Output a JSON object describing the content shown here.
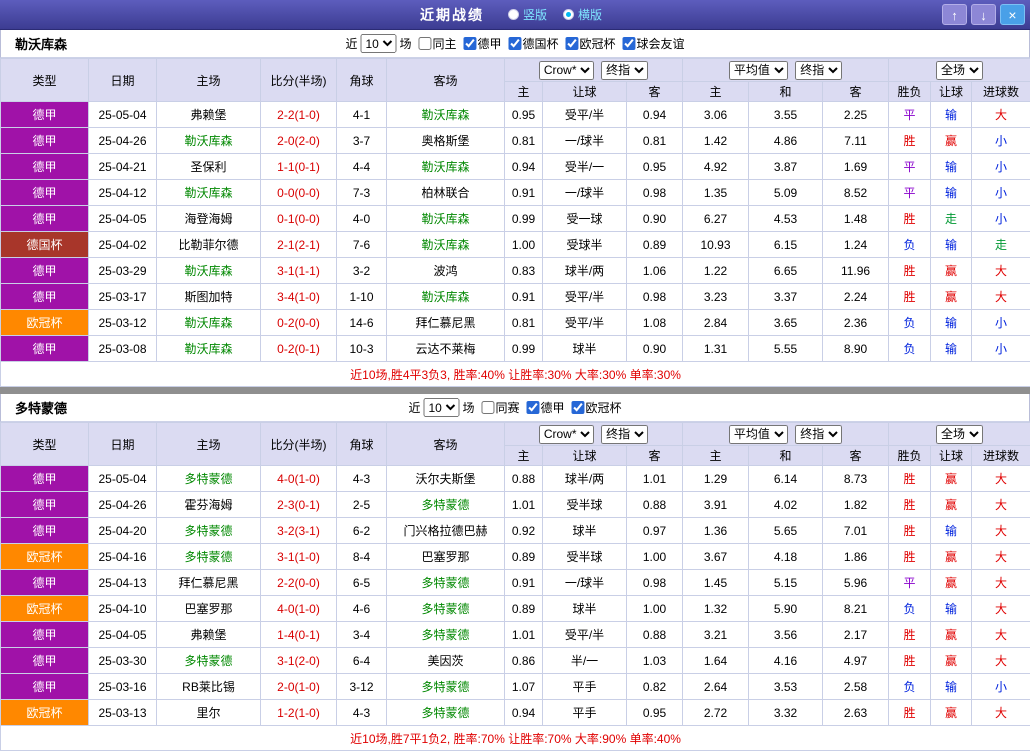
{
  "titlebar": {
    "title": "近期战绩",
    "radio_vertical": "竖版",
    "radio_horizontal": "横版",
    "up_button": "↑",
    "down_button": "↓",
    "close_button": "×"
  },
  "table_header": {
    "type": "类型",
    "date": "日期",
    "home": "主场",
    "score": "比分(半场)",
    "corner": "角球",
    "away": "客场",
    "odds_select1": "Crow*",
    "odds_select2": "终指",
    "avg_select1": "平均值",
    "avg_select2": "终指",
    "full_select": "全场",
    "odds_home": "主",
    "odds_handicap": "让球",
    "odds_away": "客",
    "avg_home": "主",
    "avg_draw": "和",
    "avg_away": "客",
    "result": "胜负",
    "handicap": "让球",
    "goals": "进球数"
  },
  "colors": {
    "badge_league": "#a012a8",
    "badge_cup": "#a8362a",
    "badge_ucl": "#ff8800",
    "win": "#e00000",
    "draw": "#8800cc",
    "loss": "#0022dd",
    "push": "#009933",
    "focus_team": "#008800",
    "score": "#d80000",
    "summary": "#e00000"
  },
  "sections": [
    {
      "team": "勒沃库森",
      "filter": {
        "near": "近",
        "count": "10",
        "games": "场",
        "options": [
          {
            "label": "同主",
            "checked": false
          },
          {
            "label": "德甲",
            "checked": true
          },
          {
            "label": "德国杯",
            "checked": true
          },
          {
            "label": "欧冠杯",
            "checked": true
          },
          {
            "label": "球会友谊",
            "checked": true
          }
        ]
      },
      "rows": [
        {
          "type": "德甲",
          "date": "25-05-04",
          "home": "弗赖堡",
          "home_focus": false,
          "score": "2-2(1-0)",
          "corner": "4-1",
          "away": "勒沃库森",
          "away_focus": true,
          "odds": [
            "0.95",
            "受平/半",
            "0.94"
          ],
          "avg": [
            "3.06",
            "3.55",
            "2.25"
          ],
          "result": "平",
          "handicap": "输",
          "goals": "大"
        },
        {
          "type": "德甲",
          "date": "25-04-26",
          "home": "勒沃库森",
          "home_focus": true,
          "score": "2-0(2-0)",
          "corner": "3-7",
          "away": "奥格斯堡",
          "away_focus": false,
          "odds": [
            "0.81",
            "一/球半",
            "0.81"
          ],
          "avg": [
            "1.42",
            "4.86",
            "7.11"
          ],
          "result": "胜",
          "handicap": "赢",
          "goals": "小"
        },
        {
          "type": "德甲",
          "date": "25-04-21",
          "home": "圣保利",
          "home_focus": false,
          "score": "1-1(0-1)",
          "corner": "4-4",
          "away": "勒沃库森",
          "away_focus": true,
          "odds": [
            "0.94",
            "受半/一",
            "0.95"
          ],
          "avg": [
            "4.92",
            "3.87",
            "1.69"
          ],
          "result": "平",
          "handicap": "输",
          "goals": "小"
        },
        {
          "type": "德甲",
          "date": "25-04-12",
          "home": "勒沃库森",
          "home_focus": true,
          "score": "0-0(0-0)",
          "corner": "7-3",
          "away": "柏林联合",
          "away_focus": false,
          "odds": [
            "0.91",
            "一/球半",
            "0.98"
          ],
          "avg": [
            "1.35",
            "5.09",
            "8.52"
          ],
          "result": "平",
          "handicap": "输",
          "goals": "小"
        },
        {
          "type": "德甲",
          "date": "25-04-05",
          "home": "海登海姆",
          "home_focus": false,
          "score": "0-1(0-0)",
          "corner": "4-0",
          "away": "勒沃库森",
          "away_focus": true,
          "odds": [
            "0.99",
            "受一球",
            "0.90"
          ],
          "avg": [
            "6.27",
            "4.53",
            "1.48"
          ],
          "result": "胜",
          "handicap": "走",
          "goals": "小"
        },
        {
          "type": "德国杯",
          "date": "25-04-02",
          "home": "比勒菲尔德",
          "home_focus": false,
          "score": "2-1(2-1)",
          "corner": "7-6",
          "away": "勒沃库森",
          "away_focus": true,
          "odds": [
            "1.00",
            "受球半",
            "0.89"
          ],
          "avg": [
            "10.93",
            "6.15",
            "1.24"
          ],
          "result": "负",
          "handicap": "输",
          "goals": "走"
        },
        {
          "type": "德甲",
          "date": "25-03-29",
          "home": "勒沃库森",
          "home_focus": true,
          "score": "3-1(1-1)",
          "corner": "3-2",
          "away": "波鸿",
          "away_focus": false,
          "odds": [
            "0.83",
            "球半/两",
            "1.06"
          ],
          "avg": [
            "1.22",
            "6.65",
            "11.96"
          ],
          "result": "胜",
          "handicap": "赢",
          "goals": "大"
        },
        {
          "type": "德甲",
          "date": "25-03-17",
          "home": "斯图加特",
          "home_focus": false,
          "score": "3-4(1-0)",
          "corner": "1-10",
          "away": "勒沃库森",
          "away_focus": true,
          "odds": [
            "0.91",
            "受平/半",
            "0.98"
          ],
          "avg": [
            "3.23",
            "3.37",
            "2.24"
          ],
          "result": "胜",
          "handicap": "赢",
          "goals": "大"
        },
        {
          "type": "欧冠杯",
          "date": "25-03-12",
          "home": "勒沃库森",
          "home_focus": true,
          "score": "0-2(0-0)",
          "corner": "14-6",
          "away": "拜仁慕尼黑",
          "away_focus": false,
          "odds": [
            "0.81",
            "受平/半",
            "1.08"
          ],
          "avg": [
            "2.84",
            "3.65",
            "2.36"
          ],
          "result": "负",
          "handicap": "输",
          "goals": "小"
        },
        {
          "type": "德甲",
          "date": "25-03-08",
          "home": "勒沃库森",
          "home_focus": true,
          "score": "0-2(0-1)",
          "corner": "10-3",
          "away": "云达不莱梅",
          "away_focus": false,
          "odds": [
            "0.99",
            "球半",
            "0.90"
          ],
          "avg": [
            "1.31",
            "5.55",
            "8.90"
          ],
          "result": "负",
          "handicap": "输",
          "goals": "小"
        }
      ],
      "summary": "近10场,胜4平3负3, 胜率:40% 让胜率:30% 大率:30% 单率:30%"
    },
    {
      "team": "多特蒙德",
      "filter": {
        "near": "近",
        "count": "10",
        "games": "场",
        "options": [
          {
            "label": "同赛",
            "checked": false
          },
          {
            "label": "德甲",
            "checked": true
          },
          {
            "label": "欧冠杯",
            "checked": true
          }
        ]
      },
      "rows": [
        {
          "type": "德甲",
          "date": "25-05-04",
          "home": "多特蒙德",
          "home_focus": true,
          "score": "4-0(1-0)",
          "corner": "4-3",
          "away": "沃尔夫斯堡",
          "away_focus": false,
          "odds": [
            "0.88",
            "球半/两",
            "1.01"
          ],
          "avg": [
            "1.29",
            "6.14",
            "8.73"
          ],
          "result": "胜",
          "handicap": "赢",
          "goals": "大"
        },
        {
          "type": "德甲",
          "date": "25-04-26",
          "home": "霍芬海姆",
          "home_focus": false,
          "score": "2-3(0-1)",
          "corner": "2-5",
          "away": "多特蒙德",
          "away_focus": true,
          "odds": [
            "1.01",
            "受半球",
            "0.88"
          ],
          "avg": [
            "3.91",
            "4.02",
            "1.82"
          ],
          "result": "胜",
          "handicap": "赢",
          "goals": "大"
        },
        {
          "type": "德甲",
          "date": "25-04-20",
          "home": "多特蒙德",
          "home_focus": true,
          "score": "3-2(3-1)",
          "corner": "6-2",
          "away": "门兴格拉德巴赫",
          "away_focus": false,
          "odds": [
            "0.92",
            "球半",
            "0.97"
          ],
          "avg": [
            "1.36",
            "5.65",
            "7.01"
          ],
          "result": "胜",
          "handicap": "输",
          "goals": "大"
        },
        {
          "type": "欧冠杯",
          "date": "25-04-16",
          "home": "多特蒙德",
          "home_focus": true,
          "score": "3-1(1-0)",
          "corner": "8-4",
          "away": "巴塞罗那",
          "away_focus": false,
          "odds": [
            "0.89",
            "受半球",
            "1.00"
          ],
          "avg": [
            "3.67",
            "4.18",
            "1.86"
          ],
          "result": "胜",
          "handicap": "赢",
          "goals": "大"
        },
        {
          "type": "德甲",
          "date": "25-04-13",
          "home": "拜仁慕尼黑",
          "home_focus": false,
          "score": "2-2(0-0)",
          "corner": "6-5",
          "away": "多特蒙德",
          "away_focus": true,
          "odds": [
            "0.91",
            "一/球半",
            "0.98"
          ],
          "avg": [
            "1.45",
            "5.15",
            "5.96"
          ],
          "result": "平",
          "handicap": "赢",
          "goals": "大"
        },
        {
          "type": "欧冠杯",
          "date": "25-04-10",
          "home": "巴塞罗那",
          "home_focus": false,
          "score": "4-0(1-0)",
          "corner": "4-6",
          "away": "多特蒙德",
          "away_focus": true,
          "odds": [
            "0.89",
            "球半",
            "1.00"
          ],
          "avg": [
            "1.32",
            "5.90",
            "8.21"
          ],
          "result": "负",
          "handicap": "输",
          "goals": "大"
        },
        {
          "type": "德甲",
          "date": "25-04-05",
          "home": "弗赖堡",
          "home_focus": false,
          "score": "1-4(0-1)",
          "corner": "3-4",
          "away": "多特蒙德",
          "away_focus": true,
          "odds": [
            "1.01",
            "受平/半",
            "0.88"
          ],
          "avg": [
            "3.21",
            "3.56",
            "2.17"
          ],
          "result": "胜",
          "handicap": "赢",
          "goals": "大"
        },
        {
          "type": "德甲",
          "date": "25-03-30",
          "home": "多特蒙德",
          "home_focus": true,
          "score": "3-1(2-0)",
          "corner": "6-4",
          "away": "美因茨",
          "away_focus": false,
          "odds": [
            "0.86",
            "半/一",
            "1.03"
          ],
          "avg": [
            "1.64",
            "4.16",
            "4.97"
          ],
          "result": "胜",
          "handicap": "赢",
          "goals": "大"
        },
        {
          "type": "德甲",
          "date": "25-03-16",
          "home": "RB莱比锡",
          "home_focus": false,
          "score": "2-0(1-0)",
          "corner": "3-12",
          "away": "多特蒙德",
          "away_focus": true,
          "odds": [
            "1.07",
            "平手",
            "0.82"
          ],
          "avg": [
            "2.64",
            "3.53",
            "2.58"
          ],
          "result": "负",
          "handicap": "输",
          "goals": "小"
        },
        {
          "type": "欧冠杯",
          "date": "25-03-13",
          "home": "里尔",
          "home_focus": false,
          "score": "1-2(1-0)",
          "corner": "4-3",
          "away": "多特蒙德",
          "away_focus": true,
          "odds": [
            "0.94",
            "平手",
            "0.95"
          ],
          "avg": [
            "2.72",
            "3.32",
            "2.63"
          ],
          "result": "胜",
          "handicap": "赢",
          "goals": "大"
        }
      ],
      "summary": "近10场,胜7平1负2, 胜率:70% 让胜率:70% 大率:90% 单率:40%"
    }
  ]
}
